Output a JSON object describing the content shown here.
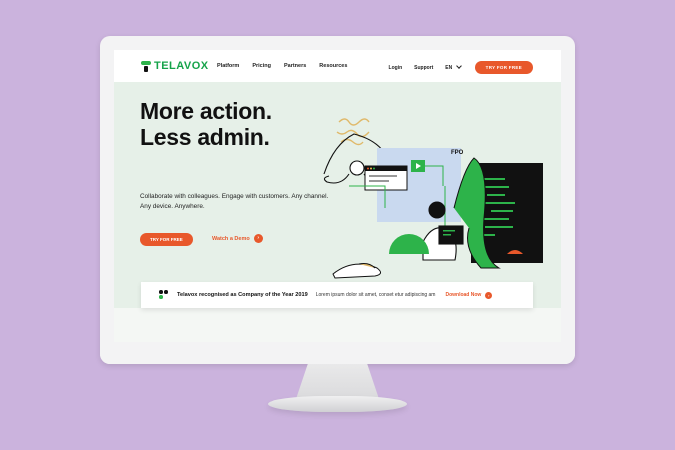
{
  "nav": {
    "logo": "TELAVOX",
    "links": [
      "Platform",
      "Pricing",
      "Partners",
      "Resources"
    ],
    "login": "Login",
    "support": "Support",
    "language": "EN",
    "cta": "TRY FOR FREE"
  },
  "hero": {
    "headline_line1": "More action.",
    "headline_line2": "Less admin.",
    "subtitle": "Collaborate with colleagues. Engage with customers. Any channel. Any device. Anywhere.",
    "cta": "TRY FOR FREE",
    "demo": "Watch a Demo",
    "fpo": "FPO"
  },
  "banner": {
    "title": "Telavox recognised as Company of the Year 2019",
    "text": "Lorem ipsum dolor sit amet, conset etur adipiscing am",
    "link": "Download Now"
  },
  "colors": {
    "brand_green": "#2db34a",
    "accent_orange": "#e8582b",
    "background_purple": "#cbb3dd"
  }
}
